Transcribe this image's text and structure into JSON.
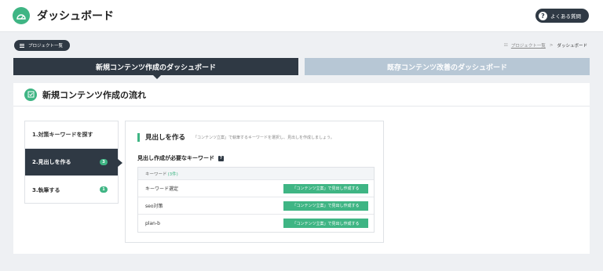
{
  "app": {
    "title": "ダッシュボード",
    "help_label": "よくある質問"
  },
  "nav": {
    "projects_button": "プロジェクト一覧",
    "breadcrumb": {
      "link": "プロジェクト一覧",
      "separator": ">",
      "current": "ダッシュボード"
    }
  },
  "tabs": [
    {
      "label": "新規コンテンツ作成のダッシュボード",
      "active": true
    },
    {
      "label": "既存コンテンツ改善のダッシュボード",
      "active": false
    }
  ],
  "panel": {
    "title": "新規コンテンツ作成の流れ"
  },
  "steps": [
    {
      "label": "1.対策キーワードを探す",
      "badge": null
    },
    {
      "label": "2.見出しを作る",
      "badge": "3"
    },
    {
      "label": "3.執筆する",
      "badge": "1"
    }
  ],
  "content": {
    "heading": "見出しを作る",
    "description": "「コンテンツ立案」で執筆するキーワードを選択し、見出しを作成しましょう。",
    "keywords_label": "見出し作成が必要なキーワード",
    "help_mark": "?",
    "table": {
      "header": "キーワード",
      "count": "(3件)",
      "rows": [
        {
          "keyword": "キーワード選定",
          "action": "「コンテンツ立案」で見出し作成する"
        },
        {
          "keyword": "seo対策",
          "action": "「コンテンツ立案」で見出し作成する"
        },
        {
          "keyword": "plan-b",
          "action": "「コンテンツ立案」で見出し作成する"
        }
      ]
    }
  },
  "colors": {
    "accent": "#3fb584",
    "dark": "#2f3944",
    "inactive_tab": "#b7c7d5"
  }
}
